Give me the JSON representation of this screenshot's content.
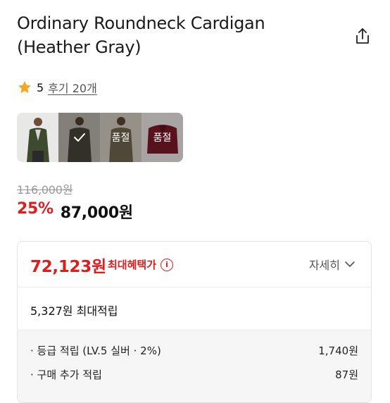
{
  "product": {
    "title": "Ordinary Roundneck Cardigan (Heather Gray)"
  },
  "rating": {
    "score": "5",
    "review_link": "후기 20개"
  },
  "options": [
    {
      "label": "",
      "selected": false,
      "soldout": false
    },
    {
      "label": "",
      "selected": true,
      "soldout": false
    },
    {
      "label": "품절",
      "selected": false,
      "soldout": true
    },
    {
      "label": "품절",
      "selected": false,
      "soldout": true
    }
  ],
  "pricing": {
    "original": "116,000원",
    "discount": "25%",
    "sale": "87,000원"
  },
  "benefit": {
    "max_price": "72,123원",
    "max_label": "최대혜택가",
    "detail_label": "자세히",
    "max_points": "5,327원 최대적립",
    "rows": [
      {
        "label": "· 등급 적립 (LV.5 실버 · 2%)",
        "value": "1,740원"
      },
      {
        "label": "· 구매 추가 적립",
        "value": "87원"
      }
    ]
  },
  "colors": {
    "accent_red": "#e21b1b",
    "star": "#f5a623"
  }
}
